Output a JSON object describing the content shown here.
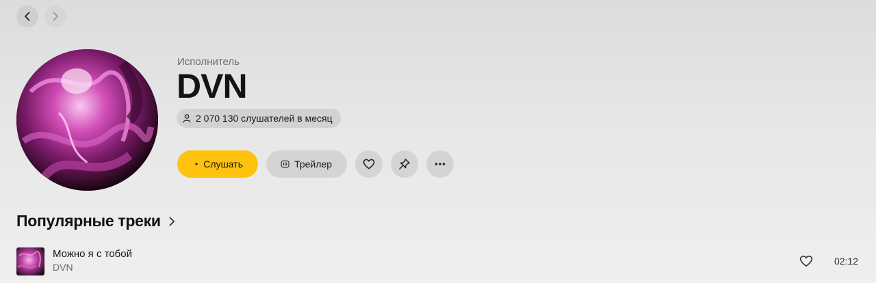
{
  "nav": {
    "back_icon": "chevron-left-icon",
    "forward_icon": "chevron-right-icon"
  },
  "artist": {
    "type_label": "Исполнитель",
    "name": "DVN",
    "listeners_text": "2 070 130 слушателей в месяц"
  },
  "actions": {
    "play_label": "Слушать",
    "trailer_label": "Трейлер"
  },
  "colors": {
    "accent": "#ffc20e",
    "button_bg": "#d4d4d4"
  },
  "popular": {
    "title": "Популярные треки",
    "tracks": [
      {
        "title": "Можно я с тобой",
        "artist": "DVN",
        "duration": "02:12"
      }
    ]
  }
}
